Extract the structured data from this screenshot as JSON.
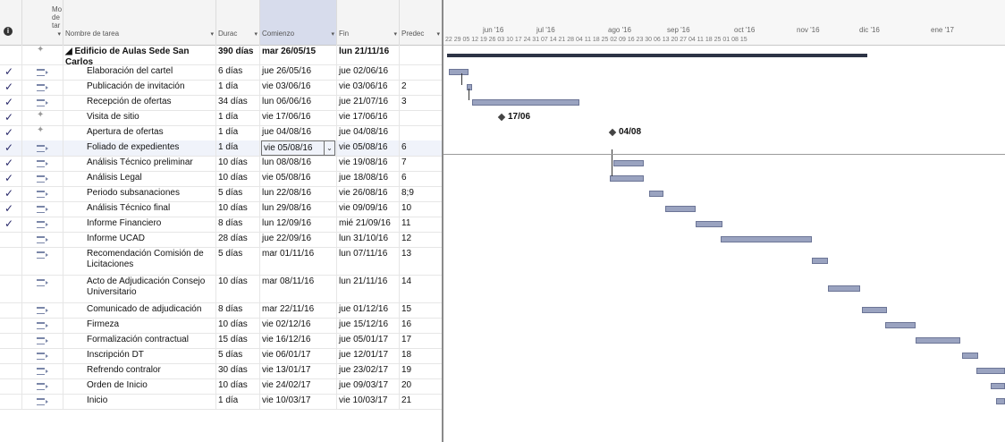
{
  "header": {
    "mode_label_line1": "Mo",
    "mode_label_line2": "de",
    "mode_label_line3": "tar",
    "col_name": "Nombre de tarea",
    "col_dur": "Durac",
    "col_start": "Comienzo",
    "col_end": "Fin",
    "col_pred": "Predec"
  },
  "gantt_header": {
    "months": [
      "jun '16",
      "jul '16",
      "ago '16",
      "sep '16",
      "oct '16",
      "nov '16",
      "dic '16",
      "ene '17"
    ],
    "weeks": "22  29  05  12  19  26  03  10  17  24  31  07  14  21  28  04  11  18  25  02  09  16  23  30  06  13  20  27  04  11  18  25  01  08  15"
  },
  "tasks": [
    {
      "done": "",
      "name": "Edificio de Aulas Sede San Carlos",
      "dur": "390 días",
      "start": "mar 26/05/15",
      "end": "lun 21/11/16",
      "pred": "",
      "summary": true
    },
    {
      "done": "✓",
      "name": "Elaboración del cartel",
      "dur": "6 días",
      "start": "jue 26/05/16",
      "end": "jue 02/06/16",
      "pred": ""
    },
    {
      "done": "✓",
      "name": "Publicación de invitación",
      "dur": "1 día",
      "start": "vie 03/06/16",
      "end": "vie 03/06/16",
      "pred": "2"
    },
    {
      "done": "✓",
      "name": "Recepción de ofertas",
      "dur": "34 días",
      "start": "lun 06/06/16",
      "end": "jue 21/07/16",
      "pred": "3"
    },
    {
      "done": "✓",
      "name": "Visita de sitio",
      "dur": "1 día",
      "start": "vie 17/06/16",
      "end": "vie 17/06/16",
      "pred": ""
    },
    {
      "done": "✓",
      "name": "Apertura de ofertas",
      "dur": "1 día",
      "start": "jue 04/08/16",
      "end": "jue 04/08/16",
      "pred": ""
    },
    {
      "done": "✓",
      "name": "Foliado de expedientes",
      "dur": "1 día",
      "start": "vie 05/08/16",
      "end": "vie 05/08/16",
      "pred": "6"
    },
    {
      "done": "✓",
      "name": "Análisis Técnico preliminar",
      "dur": "10 días",
      "start": "lun 08/08/16",
      "end": "vie 19/08/16",
      "pred": "7"
    },
    {
      "done": "✓",
      "name": "Análisis Legal",
      "dur": "10 días",
      "start": "vie 05/08/16",
      "end": "jue 18/08/16",
      "pred": "6"
    },
    {
      "done": "✓",
      "name": "Periodo subsanaciones",
      "dur": "5 días",
      "start": "lun 22/08/16",
      "end": "vie 26/08/16",
      "pred": "8;9"
    },
    {
      "done": "✓",
      "name": "Análisis Técnico final",
      "dur": "10 días",
      "start": "lun 29/08/16",
      "end": "vie 09/09/16",
      "pred": "10"
    },
    {
      "done": "✓",
      "name": "Informe Financiero",
      "dur": "8 días",
      "start": "lun 12/09/16",
      "end": "mié 21/09/16",
      "pred": "11"
    },
    {
      "done": "",
      "name": "Informe UCAD",
      "dur": "28 días",
      "start": "jue 22/09/16",
      "end": "lun 31/10/16",
      "pred": "12"
    },
    {
      "done": "",
      "name": "Recomendación Comisión de Licitaciones",
      "dur": "5 días",
      "start": "mar 01/11/16",
      "end": "lun 07/11/16",
      "pred": "13"
    },
    {
      "done": "",
      "name": "Acto de Adjudicación Consejo Universitario",
      "dur": "10 días",
      "start": "mar 08/11/16",
      "end": "lun 21/11/16",
      "pred": "14"
    },
    {
      "done": "",
      "name": "Comunicado de adjudicación",
      "dur": "8 días",
      "start": "mar 22/11/16",
      "end": "jue 01/12/16",
      "pred": "15"
    },
    {
      "done": "",
      "name": "Firmeza",
      "dur": "10 días",
      "start": "vie 02/12/16",
      "end": "jue 15/12/16",
      "pred": "16"
    },
    {
      "done": "",
      "name": "Formalización contractual",
      "dur": "15 días",
      "start": "vie 16/12/16",
      "end": "jue 05/01/17",
      "pred": "17"
    },
    {
      "done": "",
      "name": "Inscripción DT",
      "dur": "5 días",
      "start": "vie 06/01/17",
      "end": "jue 12/01/17",
      "pred": "18"
    },
    {
      "done": "",
      "name": "Refrendo contralor",
      "dur": "30 días",
      "start": "vie 13/01/17",
      "end": "jue 23/02/17",
      "pred": "19"
    },
    {
      "done": "",
      "name": "Orden de Inicio",
      "dur": "10 días",
      "start": "vie 24/02/17",
      "end": "jue 09/03/17",
      "pred": "20"
    },
    {
      "done": "",
      "name": "Inicio",
      "dur": "1 día",
      "start": "vie 10/03/17",
      "end": "vie 10/03/17",
      "pred": "21"
    }
  ],
  "milestones": [
    {
      "label": "17/06"
    },
    {
      "label": "04/08"
    }
  ],
  "colors": {
    "bar": "#9aa3c0",
    "bar_border": "#6c7596",
    "summary": "#2d3446",
    "check": "#2a2a6a"
  }
}
